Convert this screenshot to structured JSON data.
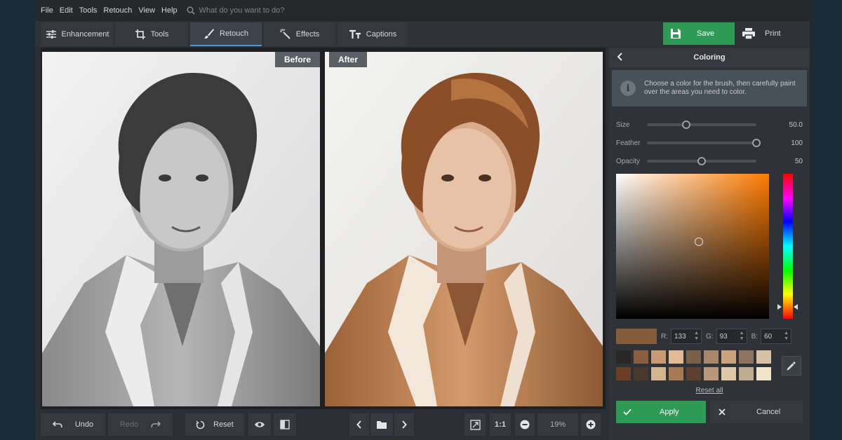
{
  "menu": {
    "items": [
      "File",
      "Edit",
      "Tools",
      "Retouch",
      "View",
      "Help"
    ],
    "search_placeholder": "What do you want to do?"
  },
  "toolbar": {
    "tabs": [
      {
        "label": "Enhancement",
        "icon": "sliders-icon"
      },
      {
        "label": "Tools",
        "icon": "crop-icon"
      },
      {
        "label": "Retouch",
        "icon": "brush-icon",
        "active": true
      },
      {
        "label": "Effects",
        "icon": "magic-wand-icon"
      },
      {
        "label": "Captions",
        "icon": "text-icon"
      }
    ],
    "save_label": "Save",
    "print_label": "Print"
  },
  "canvas": {
    "before_label": "Before",
    "after_label": "After"
  },
  "bottombar": {
    "undo_label": "Undo",
    "redo_label": "Redo",
    "reset_label": "Reset",
    "actual_size_label": "1:1",
    "zoom_value": "19%"
  },
  "panel": {
    "title": "Coloring",
    "info_text": "Choose a color for the brush, then carefully paint over the areas you need to color.",
    "sliders": [
      {
        "label": "Size",
        "value": "50.0",
        "fraction": 0.36
      },
      {
        "label": "Feather",
        "value": "100",
        "fraction": 1.0
      },
      {
        "label": "Opacity",
        "value": "50",
        "fraction": 0.5
      }
    ],
    "rgb": {
      "r_label": "R:",
      "r": "133",
      "g_label": "G:",
      "g": "93",
      "b_label": "B:",
      "b": "60"
    },
    "current_color": "#855d3c",
    "hue_color": "#ff7a00",
    "swatches": [
      "#2a2623",
      "#8a5f3f",
      "#c89b74",
      "#e2bb96",
      "#7a6048",
      "#a9876a",
      "#c9a47f",
      "#8e7460",
      "#d8c2a6",
      "#6b3f24",
      "#4a3a2e",
      "#d7b491",
      "#a87a54",
      "#5d4030",
      "#b99778",
      "#e0c7a8",
      "#c0aa90",
      "#f0e4c9"
    ],
    "reset_all_label": "Reset all",
    "apply_label": "Apply",
    "cancel_label": "Cancel"
  }
}
